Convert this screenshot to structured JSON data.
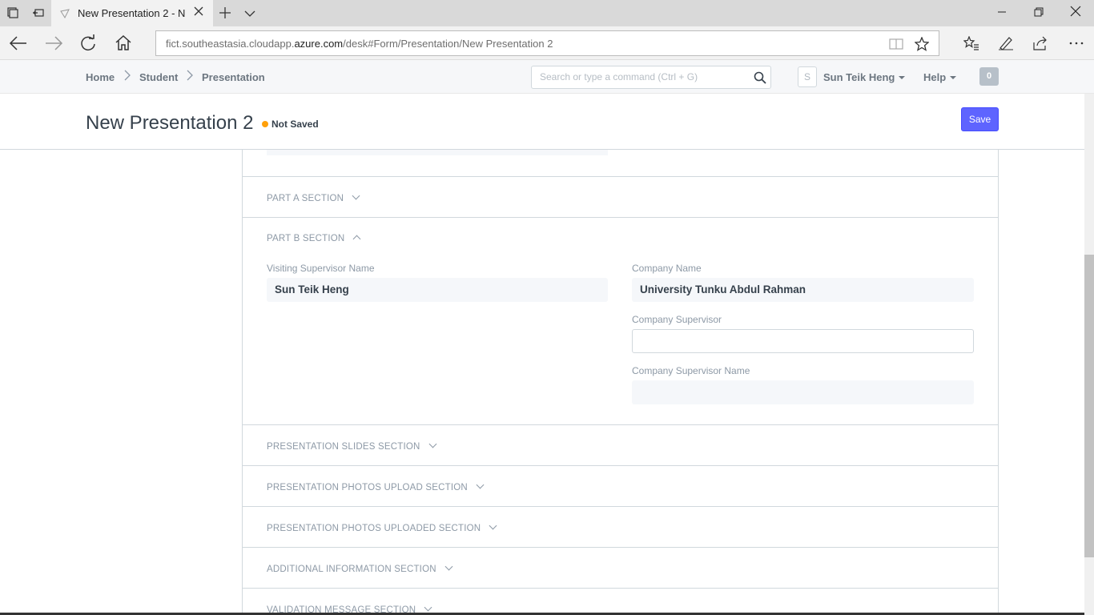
{
  "browser": {
    "tab_title": "New Presentation 2 - N",
    "url_prefix": "fict.southeastasia.cloudapp.",
    "url_domain": "azure.com",
    "url_suffix": "/desk#Form/Presentation/New Presentation 2"
  },
  "appbar": {
    "breadcrumbs": [
      "Home",
      "Student",
      "Presentation"
    ],
    "search_placeholder": "Search or type a command (Ctrl + G)",
    "avatar_initial": "S",
    "user_name": "Sun Teik Heng",
    "help_label": "Help",
    "notification_count": "0"
  },
  "page": {
    "title": "New Presentation 2",
    "status": "Not Saved",
    "status_color": "#ffa00a",
    "save_label": "Save",
    "save_color": "#5e64ff"
  },
  "form": {
    "part_a_title": "PART A SECTION",
    "part_b_title": "PART B SECTION",
    "visiting_supervisor_label": "Visiting Supervisor Name",
    "visiting_supervisor_value": "Sun Teik Heng",
    "company_name_label": "Company Name",
    "company_name_value": "University Tunku Abdul Rahman",
    "company_supervisor_label": "Company Supervisor",
    "company_supervisor_value": "",
    "company_supervisor_name_label": "Company Supervisor Name",
    "company_supervisor_name_value": "",
    "slides_title": "PRESENTATION SLIDES SECTION",
    "photos_upload_title": "PRESENTATION PHOTOS UPLOAD SECTION",
    "photos_uploaded_title": "PRESENTATION PHOTOS UPLOADED SECTION",
    "additional_title": "ADDITIONAL INFORMATION SECTION",
    "validation_title": "VALIDATION MESSAGE SECTION"
  }
}
